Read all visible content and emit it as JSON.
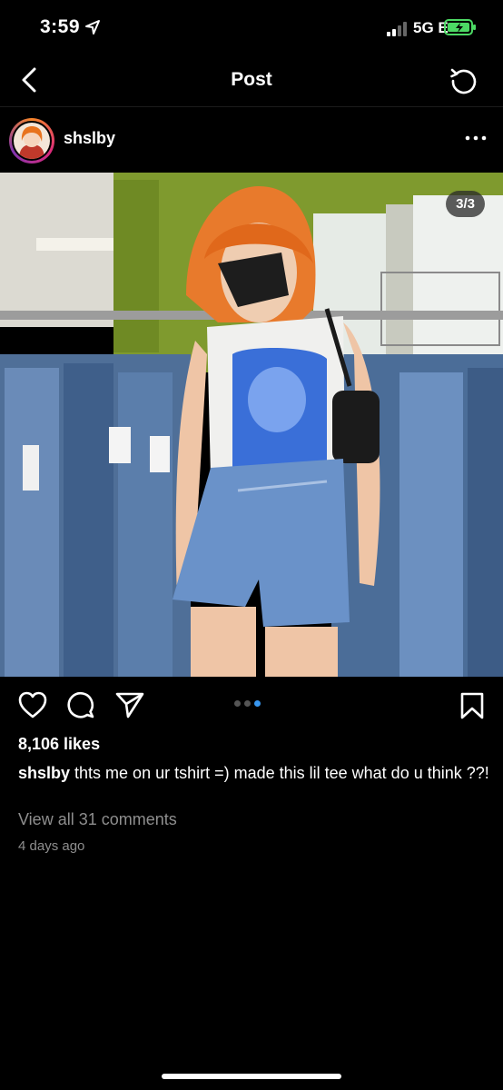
{
  "status_bar": {
    "time": "3:59",
    "network": "5G E"
  },
  "nav": {
    "title": "Post"
  },
  "post": {
    "username": "shslby",
    "image_counter": "3/3",
    "carousel": {
      "total": 3,
      "current": 3
    },
    "likes": "8,106 likes",
    "caption_user": "shslby",
    "caption_text": " thts me on ur tshirt =) made this lil tee what do u think ??!",
    "view_comments": "View all 31 comments",
    "time_ago": "4 days ago"
  },
  "colors": {
    "background": "#000000",
    "accent_blue": "#3897f0",
    "secondary_text": "#8e8e8e",
    "battery_green": "#4cd964"
  },
  "icons": [
    "location-arrow-icon",
    "signal-icon",
    "battery-icon",
    "back-icon",
    "refresh-icon",
    "more-icon",
    "heart-icon",
    "comment-icon",
    "share-icon",
    "save-icon"
  ]
}
